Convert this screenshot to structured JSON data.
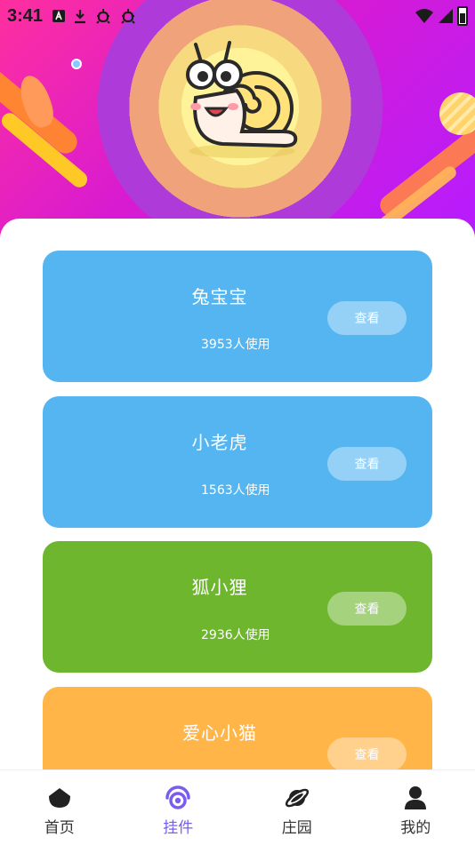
{
  "status_bar": {
    "time": "3:41",
    "icons": [
      "a-box-icon",
      "download-icon",
      "bug-icon",
      "bug-icon"
    ],
    "system": [
      "wifi-icon",
      "signal-icon",
      "battery-icon"
    ]
  },
  "banner": {
    "mascot": "snail-icon",
    "colors": {
      "primary": "#d81bd1",
      "accent": "#fff39a"
    }
  },
  "cards": [
    {
      "title": "兔宝宝",
      "count": "3953人使用",
      "button": "查看",
      "color": "#54b5f0"
    },
    {
      "title": "小老虎",
      "count": "1563人使用",
      "button": "查看",
      "color": "#54b5f0"
    },
    {
      "title": "狐小狸",
      "count": "2936人使用",
      "button": "查看",
      "color": "#6db62e"
    },
    {
      "title": "爱心小猫",
      "count": "",
      "button": "查看",
      "color": "#ffb547"
    }
  ],
  "bottom_nav": {
    "active_color": "#7b5cf0",
    "items": [
      {
        "label": "首页",
        "icon": "home-icon",
        "active": false
      },
      {
        "label": "挂件",
        "icon": "pendant-icon",
        "active": true
      },
      {
        "label": "庄园",
        "icon": "planet-icon",
        "active": false
      },
      {
        "label": "我的",
        "icon": "user-icon",
        "active": false
      }
    ]
  }
}
